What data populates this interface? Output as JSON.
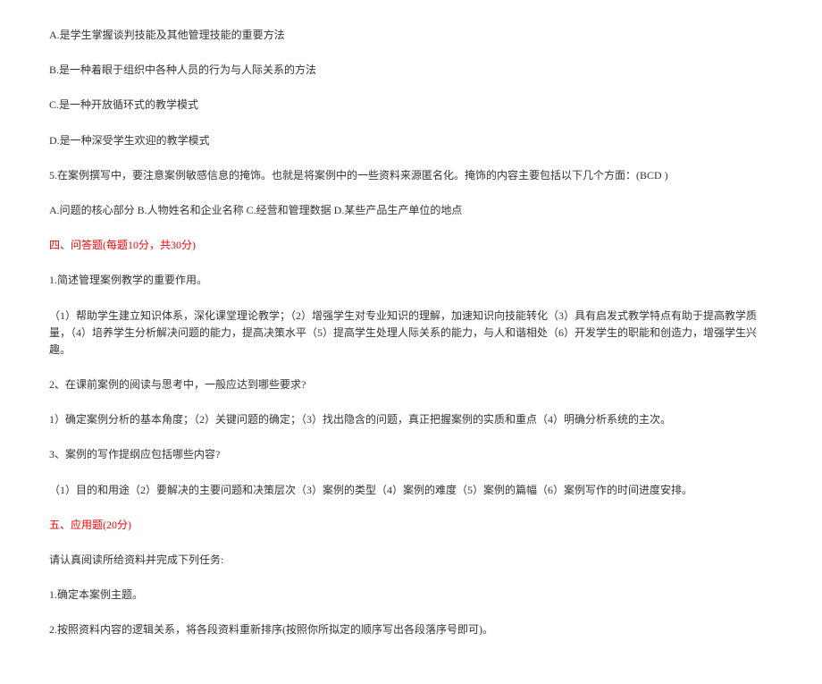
{
  "lines": [
    {
      "text": "A.是学生掌握谈判技能及其他管理技能的重要方法",
      "highlight": false
    },
    {
      "text": "B.是一种着眼于组织中各种人员的行为与人际关系的方法",
      "highlight": false
    },
    {
      "text": "C.是一种开放循环式的教学模式",
      "highlight": false
    },
    {
      "text": "D.是一种深受学生欢迎的教学模式",
      "highlight": false
    },
    {
      "text": "5.在案例撰写中，要注意案例敏感信息的掩饰。也就是将案例中的一些资料来源匿名化。掩饰的内容主要包括以下几个方面：(BCD )",
      "highlight": false
    },
    {
      "text": "A.问题的核心部分 B.人物姓名和企业名称 C.经营和管理数据 D.某些产品生产单位的地点",
      "highlight": false
    },
    {
      "text": "四、问答题(每题10分，共30分)",
      "highlight": true
    },
    {
      "text": "1.简述管理案例教学的重要作用。",
      "highlight": false
    },
    {
      "text": "（1）帮助学生建立知识体系，深化课堂理论教学；（2）增强学生对专业知识的理解，加速知识向技能转化（3）具有启发式教学特点有助于提高教学质量，（4）培养学生分析解决问题的能力，提高决策水平（5）提高学生处理人际关系的能力，与人和谐相处（6）开发学生的职能和创造力，增强学生兴趣。",
      "highlight": false
    },
    {
      "text": "2、在课前案例的阅读与思考中，一般应达到哪些要求?",
      "highlight": false
    },
    {
      "text": "1）确定案例分析的基本角度；（2）关键问题的确定；（3）找出隐含的问题，真正把握案例的实质和重点（4）明确分析系统的主次。",
      "highlight": false
    },
    {
      "text": "3、案例的写作提纲应包括哪些内容?",
      "highlight": false
    },
    {
      "text": "（1）目的和用途（2）要解决的主要问题和决策层次（3）案例的类型（4）案例的难度（5）案例的篇幅（6）案例写作的时间进度安排。",
      "highlight": false
    },
    {
      "text": "五、应用题(20分)",
      "highlight": true
    },
    {
      "text": "请认真阅读所给资料并完成下列任务:",
      "highlight": false
    },
    {
      "text": "1.确定本案例主题。",
      "highlight": false
    },
    {
      "text": "2.按照资料内容的逻辑关系，将各段资料重新排序(按照你所拟定的顺序写出各段落序号即可)。",
      "highlight": false
    }
  ]
}
